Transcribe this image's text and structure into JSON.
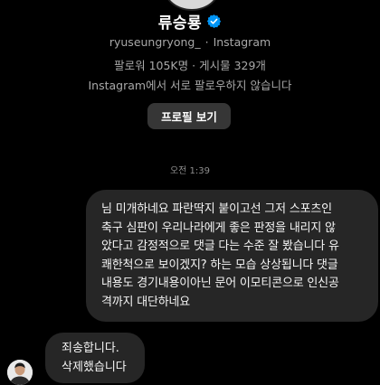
{
  "profile": {
    "name": "류승룡",
    "handle": "ryuseungryong_",
    "platform": "Instagram",
    "followers_label": "팔로워",
    "followers_count": "105K명",
    "posts_label": "게시물",
    "posts_count": "329개",
    "mutual_text": "Instagram에서 서로 팔로우하지 않습니다",
    "view_profile_label": "프로필 보기"
  },
  "conversation": {
    "timestamp": "오전 1:39",
    "messages": [
      {
        "direction": "outgoing",
        "text": "님 미개하네요 파란딱지 붙이고선 그저 스포츠인\n축구 심판이 우리나라에게 좋은 판정을 내리지 않\n았다고 감정적으로 댓글 다는 수준 잘 봤습니다 유\n쾌한척으로 보이겠지? 하는 모습 상상됩니다 댓글\n내용도 경기내용이아닌 문어 이모티콘으로 인신공\n격까지 대단하네요"
      },
      {
        "direction": "incoming",
        "text": "죄송합니다.\n삭제했습니다"
      }
    ]
  },
  "colors": {
    "background": "#000000",
    "bubble": "#262626",
    "button": "#363636",
    "secondary_text": "#a8a8a8",
    "verified_badge": "#0095f6"
  },
  "icons": {
    "verified": "verified-badge-icon",
    "avatar": "person-avatar-icon"
  }
}
